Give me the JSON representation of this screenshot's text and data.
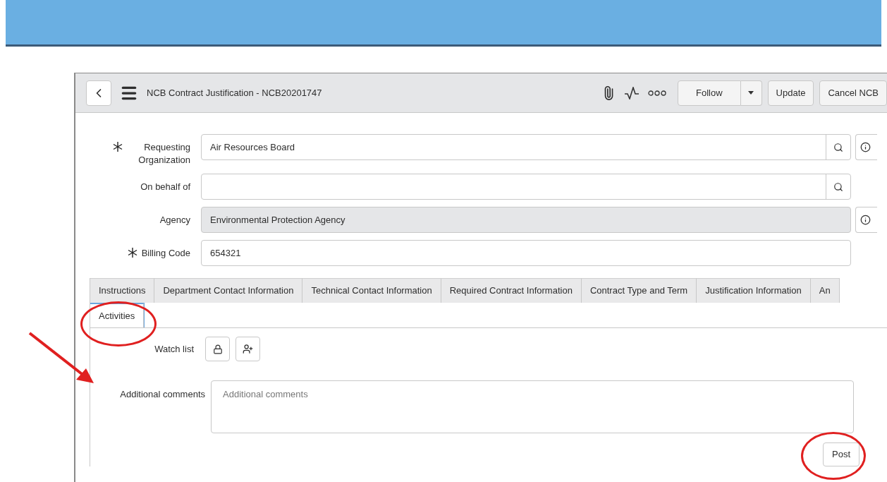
{
  "header": {
    "title": "NCB Contract Justification - NCB20201747",
    "buttons": [
      {
        "label": "Follow",
        "kind": "split"
      },
      {
        "label": "Update",
        "kind": "plain"
      },
      {
        "label": "Cancel NCB",
        "kind": "plain"
      }
    ]
  },
  "fields": [
    {
      "label": "Requesting Organization",
      "required": true,
      "value": "Air Resources Board",
      "readonly": false,
      "lookup": true,
      "info": true
    },
    {
      "label": "On behalf of",
      "required": false,
      "readonly": false,
      "lookup": true,
      "info": false
    },
    {
      "label": "Agency",
      "required": false,
      "value": "Environmental Protection Agency",
      "readonly": true,
      "lookup": false,
      "info": true
    },
    {
      "label": "Billing Code",
      "required": true,
      "value": "654321",
      "readonly": false,
      "lookup": false,
      "info": false
    }
  ],
  "tabs": [
    {
      "label": "Instructions",
      "selected": false
    },
    {
      "label": "Department Contact Information",
      "selected": false
    },
    {
      "label": "Technical Contact Information",
      "selected": false
    },
    {
      "label": "Required Contract Information",
      "selected": false
    },
    {
      "label": "Contract Type and Term",
      "selected": false
    },
    {
      "label": "Justification Information",
      "selected": false
    },
    {
      "label": "An",
      "selected": false
    },
    {
      "label": "Activities",
      "selected": true
    }
  ],
  "activities": {
    "watch_list_label": "Watch list",
    "comments_label": "Additional comments",
    "comments_placeholder": "Additional comments",
    "post_button": "Post"
  }
}
